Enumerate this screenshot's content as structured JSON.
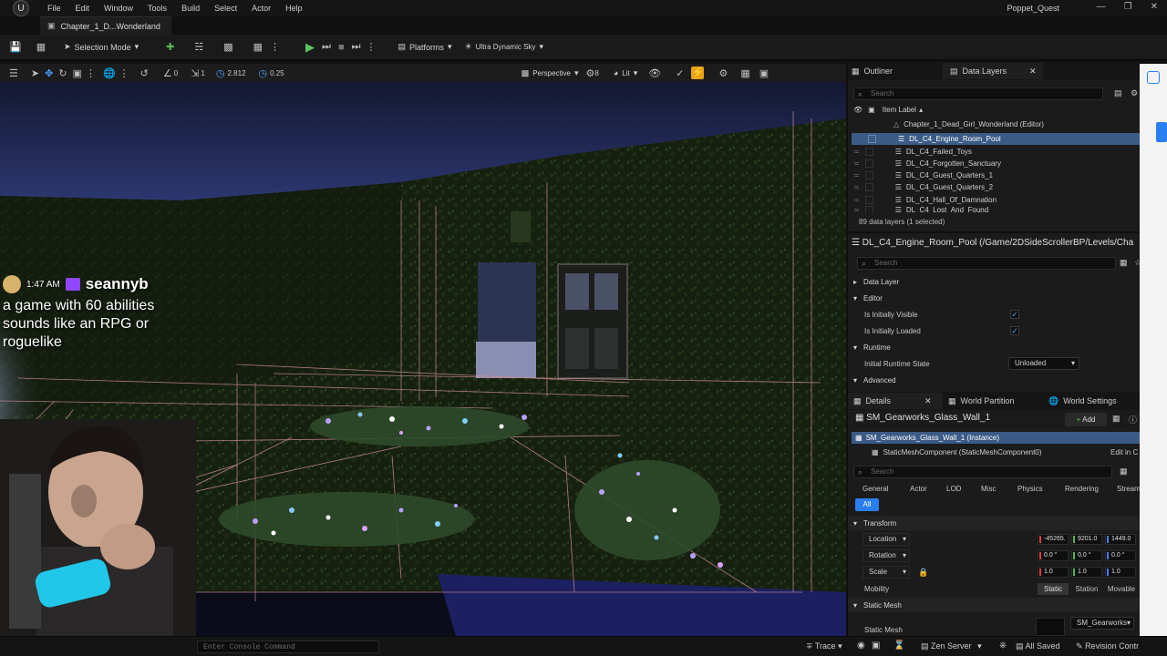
{
  "menubar": {
    "items": [
      "File",
      "Edit",
      "Window",
      "Tools",
      "Build",
      "Select",
      "Actor",
      "Help"
    ],
    "project": "Poppet_Quest"
  },
  "level_tab": "Chapter_1_D...Wonderland",
  "toolbar": {
    "mode": "Selection Mode",
    "platforms": "Platforms",
    "sky": "Ultra Dynamic Sky"
  },
  "viewport_bar": {
    "rot_snap": "0",
    "scale_snap": "1",
    "cam_speed": "2.812",
    "grid": "0.25",
    "perspective": "Perspective",
    "fov": "8",
    "lit": "Lit"
  },
  "outliner": {
    "tabs": [
      "Outliner",
      "Data Layers"
    ],
    "search_placeholder": "Search",
    "column": "Item Label",
    "root": "Chapter_1_Dead_Girl_Wonderland (Editor)",
    "layers": [
      "DL_C4_Engine_Room_Pool",
      "DL_C4_Failed_Toys",
      "DL_C4_Forgotten_Sanctuary",
      "DL_C4_Guest_Quarters_1",
      "DL_C4_Guest_Quarters_2",
      "DL_C4_Hall_Of_Damnation",
      "DL_C4_Lost_And_Found"
    ],
    "count": "89 data layers (1 selected)"
  },
  "layer_details": {
    "title": "DL_C4_Engine_Room_Pool (/Game/2DSideScrollerBP/Levels/Cha",
    "search_placeholder": "Search",
    "sections": {
      "data_layer": "Data Layer",
      "editor": "Editor",
      "runtime": "Runtime",
      "advanced": "Advanced"
    },
    "props": {
      "visible": "Is Initially Visible",
      "loaded": "Is Initially Loaded",
      "runtime_state": "Initial Runtime State",
      "runtime_value": "Unloaded"
    }
  },
  "details": {
    "tabs": [
      "Details",
      "World Partition",
      "World Settings"
    ],
    "actor": "SM_Gearworks_Glass_Wall_1",
    "add": "Add",
    "instance": "SM_Gearworks_Glass_Wall_1 (Instance)",
    "component": "StaticMeshComponent (StaticMeshComponent0)",
    "edit_in": "Edit in C",
    "search_placeholder": "Search",
    "filters": [
      "General",
      "Actor",
      "LOD",
      "Misc",
      "Physics",
      "Rendering",
      "Stream"
    ],
    "filter_all": "All",
    "transform": "Transform",
    "location_label": "Location",
    "location": [
      "-45265.",
      "9201.0",
      "1449.0"
    ],
    "rotation_label": "Rotation",
    "rotation": [
      "0.0 °",
      "0.0 °",
      "0.0 °"
    ],
    "scale_label": "Scale",
    "scale": [
      "1.0",
      "1.0",
      "1.0"
    ],
    "mobility_label": "Mobility",
    "mobility": [
      "Static",
      "Station",
      "Movable"
    ],
    "static_mesh_section": "Static Mesh",
    "static_mesh_label": "Static Mesh",
    "static_mesh_value": "SM_Gearworks"
  },
  "chat": {
    "time": "1:47 AM",
    "user": "seannyb",
    "message": "a game with 60 abilities sounds like an RPG or roguelike"
  },
  "console": {
    "placeholder": "Enter Console Command"
  },
  "statusbar": {
    "trace": "Trace",
    "zen": "Zen Server",
    "saved": "All Saved",
    "revision": "Revision Contr"
  }
}
